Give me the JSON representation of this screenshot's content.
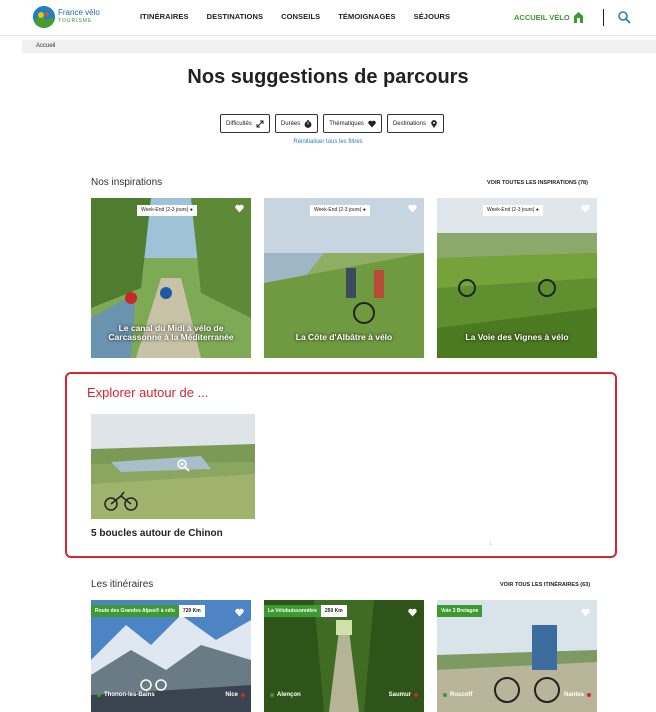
{
  "header": {
    "logo": {
      "line1": "France vélo",
      "line2": "TOURISME"
    },
    "nav": [
      "ITINÉRAIRES",
      "DESTINATIONS",
      "CONSEILS",
      "TÉMOIGNAGES",
      "SÉJOURS"
    ],
    "accueil_velo": "ACCUEIL VÉLO",
    "search_icon": "search-icon"
  },
  "breadcrumb": "Accueil",
  "title": "Nos suggestions de parcours",
  "filters": [
    {
      "label": "Difficultés",
      "icon": "arrows-icon"
    },
    {
      "label": "Durées",
      "icon": "timer-icon"
    },
    {
      "label": "Thématiques",
      "icon": "heart-icon"
    },
    {
      "label": "Destinations",
      "icon": "pin-icon"
    }
  ],
  "reset_label": "Réinitialiser tous les filtres",
  "inspirations": {
    "title": "Nos inspirations",
    "link": "VOIR TOUTES LES INSPIRATIONS (78)",
    "cards": [
      {
        "tag": "Week-End (2-3 jours)",
        "title": "Le canal du Midi à vélo de Carcassonne à la Méditerranée"
      },
      {
        "tag": "Week-End (2-3 jours)",
        "title": "La Côte d'Albâtre à vélo"
      },
      {
        "tag": "Week-End (2-3 jours)",
        "title": "La Voie des Vignes à vélo"
      }
    ]
  },
  "explore": {
    "title": "Explorer autour de ...",
    "card_title": "5 boucles autour de Chinon"
  },
  "itineraries": {
    "title": "Les itinéraires",
    "link": "VOIR TOUS LES ITINÉRAIRES (63)",
    "cards": [
      {
        "route": "Route des Grandes Alpes® à vélo",
        "distance": "720 Km",
        "from": "Thonon-les-Bains",
        "to": "Nice"
      },
      {
        "route": "La Vélobuissonnière",
        "distance": "250 Km",
        "from": "Alençon",
        "to": "Saumur"
      },
      {
        "route": "Voie 3 Bretagne",
        "distance": "",
        "from": "Roscoff",
        "to": "Nantes"
      }
    ]
  },
  "colors": {
    "green": "#3c9a31",
    "red": "#d7262f",
    "blue": "#1f7fc7"
  }
}
